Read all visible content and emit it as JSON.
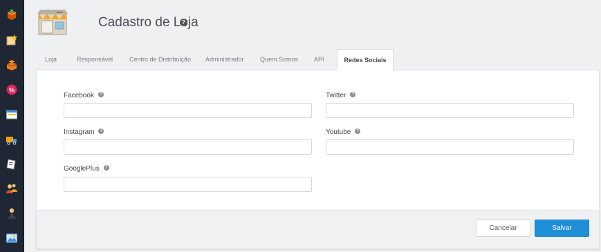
{
  "sidebar": {
    "items": [
      {
        "icon": "store-box-icon"
      },
      {
        "icon": "catalog-star-icon"
      },
      {
        "icon": "boxes-icon"
      },
      {
        "icon": "discount-percent-icon"
      },
      {
        "icon": "window-browser-icon"
      },
      {
        "icon": "delivery-truck-icon"
      },
      {
        "icon": "note-card-icon"
      },
      {
        "icon": "users-icon"
      },
      {
        "icon": "person-icon"
      },
      {
        "icon": "image-gallery-icon"
      }
    ]
  },
  "header": {
    "title": "Cadastro de Loja",
    "help": "?"
  },
  "tabs": [
    {
      "label": "Loja",
      "active": false
    },
    {
      "label": "Responsável",
      "active": false
    },
    {
      "label": "Centro de Distribuição",
      "active": false
    },
    {
      "label": "Administrador",
      "active": false
    },
    {
      "label": "Quem Somos",
      "active": false
    },
    {
      "label": "API",
      "active": false
    },
    {
      "label": "Redes Sociais",
      "active": true
    }
  ],
  "form": {
    "facebook": {
      "label": "Facebook",
      "value": ""
    },
    "twitter": {
      "label": "Twitter",
      "value": ""
    },
    "instagram": {
      "label": "Instagram",
      "value": ""
    },
    "youtube": {
      "label": "Youtube",
      "value": ""
    },
    "googleplus": {
      "label": "GooglePlus",
      "value": ""
    },
    "help": "?"
  },
  "footer": {
    "cancel_label": "Cancelar",
    "save_label": "Salvar"
  },
  "colors": {
    "sidebar_bg": "#1e2733",
    "accent": "#1f8fd8",
    "page_bg": "#eff0f2"
  }
}
